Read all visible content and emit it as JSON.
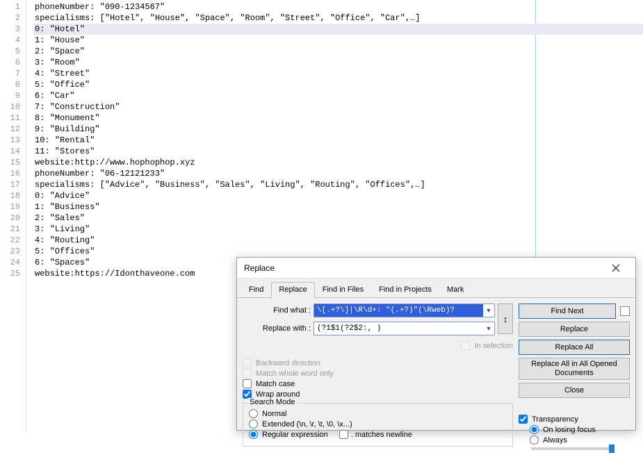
{
  "editor": {
    "lines": [
      "phoneNumber: \"090-1234567\"",
      "specialisms: [\"Hotel\", \"House\", \"Space\", \"Room\", \"Street\", \"Office\", \"Car\",…]",
      "0: \"Hotel\"",
      "1: \"House\"",
      "2: \"Space\"",
      "3: \"Room\"",
      "4: \"Street\"",
      "5: \"Office\"",
      "6: \"Car\"",
      "7: \"Construction\"",
      "8: \"Monument\"",
      "9: \"Building\"",
      "10: \"Rental\"",
      "11: \"Stores\"",
      "website:http://www.hophophop.xyz",
      "phoneNumber: \"06-12121233\"",
      "specialisms: [\"Advice\", \"Business\", \"Sales\", \"Living\", \"Routing\", \"Offices\",…]",
      "0: \"Advice\"",
      "1: \"Business\"",
      "2: \"Sales\"",
      "3: \"Living\"",
      "4: \"Routing\"",
      "5: \"Offices\"",
      "6: \"Spaces\"",
      "website:https://Idonthaveone.com"
    ],
    "highlight_line": 3,
    "line_count": 25
  },
  "dialog": {
    "title": "Replace",
    "tabs": {
      "find": "Find",
      "replace": "Replace",
      "find_in_files": "Find in Files",
      "find_in_projects": "Find in Projects",
      "mark": "Mark"
    },
    "find_label": "Find what :",
    "replace_label": "Replace with :",
    "find_value": "\\[.+?\\]|\\R\\d+: \"(.+?)\"(\\Rweb)?",
    "replace_value": "(?1$1(?2$2:, )",
    "swap": "↕",
    "in_selection": "In selection",
    "buttons": {
      "find_next": "Find Next",
      "replace": "Replace",
      "replace_all": "Replace All",
      "replace_all_opened": "Replace All in All Opened Documents",
      "close": "Close"
    },
    "options": {
      "backward": "Backward direction",
      "whole_word": "Match whole word only",
      "match_case": "Match case",
      "wrap": "Wrap around"
    },
    "search_mode": {
      "legend": "Search Mode",
      "normal": "Normal",
      "extended": "Extended (\\n, \\r, \\t, \\0, \\x...)",
      "regex": "Regular expression",
      "dot_newline": ". matches newline"
    },
    "transparency": {
      "label": "Transparency",
      "losing_focus": "On losing focus",
      "always": "Always"
    }
  }
}
